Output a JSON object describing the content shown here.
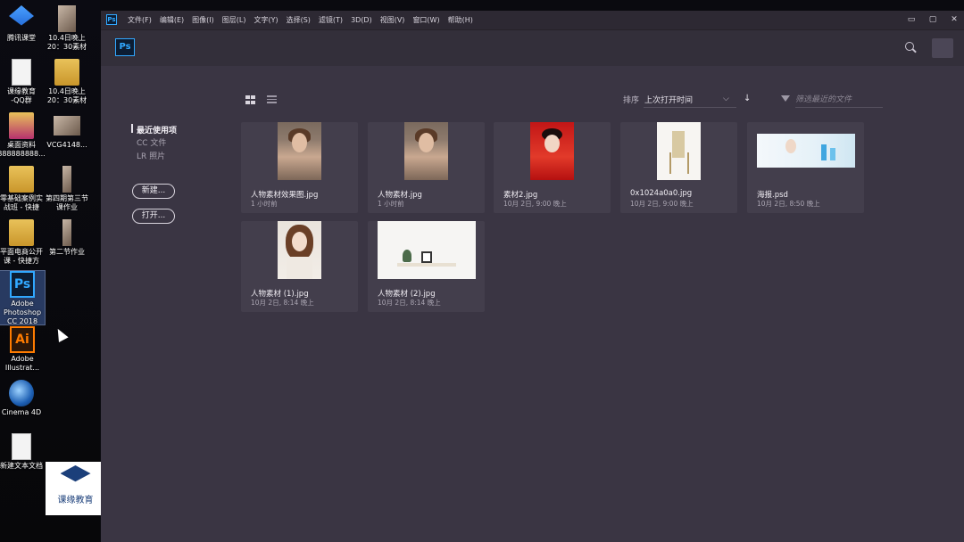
{
  "desktop": {
    "icons": [
      {
        "label": "腾讯课堂"
      },
      {
        "label": "10.4日晚上\n20：30素材"
      },
      {
        "label": "课缘教育\n-QQ群"
      },
      {
        "label": "10.4日晚上\n20：30素材"
      },
      {
        "label": "桌面资料\n888888888..."
      },
      {
        "label": "VCG4148..."
      },
      {
        "label": "零基础案例实\n战班 - 快捷"
      },
      {
        "label": "第四期第三节\n课作业"
      },
      {
        "label": "平面电商公开\n课 - 快捷方"
      },
      {
        "label": "第二节作业"
      },
      {
        "label": "Adobe\nPhotoshop\nCC 2018",
        "badge": "Ps"
      },
      {
        "label": "Adobe\nIllustrat...",
        "badge": "Ai"
      },
      {
        "label": "Cinema 4D"
      },
      {
        "label": "新建文本文档"
      }
    ],
    "watermark_label": "课缘教育"
  },
  "ps": {
    "menubar_logo": "Ps",
    "menus": [
      "文件(F)",
      "编辑(E)",
      "图像(I)",
      "图层(L)",
      "文字(Y)",
      "选择(S)",
      "滤镜(T)",
      "3D(D)",
      "视图(V)",
      "窗口(W)",
      "帮助(H)"
    ],
    "window_controls": {
      "minimize": "▭",
      "restore": "▢",
      "close": "✕"
    },
    "header_logo": "Ps",
    "sort": {
      "label": "排序",
      "value": "上次打开时间",
      "chevron": "⌵",
      "direction": "↓"
    },
    "filter": {
      "placeholder": "筛选最近的文件"
    },
    "nav": {
      "items": [
        "最近使用项",
        "CC 文件",
        "LR 照片"
      ],
      "active_index": 0
    },
    "buttons": {
      "new": "新建...",
      "open": "打开..."
    },
    "files": [
      {
        "name": "人物素材效果图.jpg",
        "time": "1 小时前"
      },
      {
        "name": "人物素材.jpg",
        "time": "1 小时前"
      },
      {
        "name": "素材2.jpg",
        "time": "10月 2日, 9:00 晚上"
      },
      {
        "name": "0x1024a0a0.jpg",
        "time": "10月 2日, 9:00 晚上"
      },
      {
        "name": "海报.psd",
        "time": "10月 2日, 8:50 晚上"
      },
      {
        "name": "人物素材 (1).jpg",
        "time": "10月 2日, 8:14 晚上"
      },
      {
        "name": "人物素材 (2).jpg",
        "time": "10月 2日, 8:14 晚上"
      }
    ]
  }
}
